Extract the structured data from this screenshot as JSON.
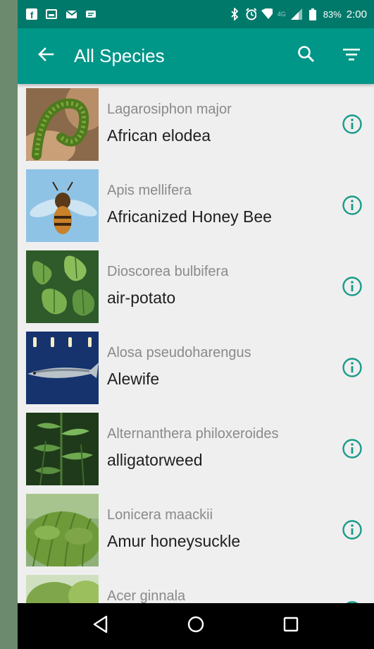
{
  "status_bar": {
    "battery": "83%",
    "time": "2:00",
    "network": "4G",
    "icons": [
      "facebook-icon",
      "image-icon",
      "mail-icon",
      "message-icon",
      "bluetooth-icon",
      "alarm-icon",
      "wifi-icon",
      "signal-icon",
      "battery-icon"
    ]
  },
  "app_bar": {
    "title": "All Species",
    "back_icon": "arrow-back-icon",
    "search_icon": "search-icon",
    "sort_icon": "sort-icon"
  },
  "species": [
    {
      "scientific": "Lagarosiphon major",
      "common": "African elodea",
      "thumb": "aquatic-plant"
    },
    {
      "scientific": "Apis mellifera",
      "common": "Africanized Honey Bee",
      "thumb": "bee"
    },
    {
      "scientific": "Dioscorea bulbifera",
      "common": "air-potato",
      "thumb": "heart-leaves"
    },
    {
      "scientific": "Alosa pseudoharengus",
      "common": "Alewife",
      "thumb": "fish"
    },
    {
      "scientific": "Alternanthera philoxeroides",
      "common": "alligatorweed",
      "thumb": "weed"
    },
    {
      "scientific": "Lonicera maackii",
      "common": "Amur honeysuckle",
      "thumb": "shrub"
    },
    {
      "scientific": "Acer ginnala",
      "common": "",
      "thumb": "tree"
    }
  ],
  "nav_bar": {
    "back": "nav-back-icon",
    "home": "nav-home-icon",
    "recents": "nav-recents-icon"
  },
  "colors": {
    "app_bar": "#009688",
    "status_bar": "#00796b",
    "info_icon": "#1a9b8a",
    "list_background": "#efefef"
  }
}
